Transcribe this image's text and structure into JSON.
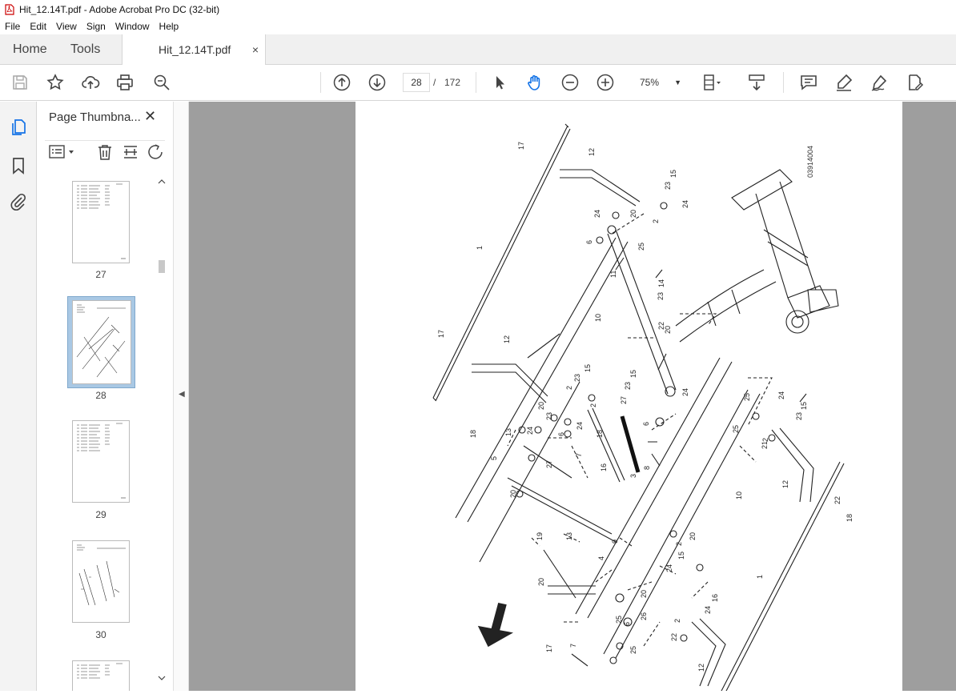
{
  "window": {
    "title": "Hit_12.14T.pdf - Adobe Acrobat Pro DC (32-bit)"
  },
  "menu": [
    "File",
    "Edit",
    "View",
    "Sign",
    "Window",
    "Help"
  ],
  "tabs": {
    "home": "Home",
    "tools": "Tools",
    "document": "Hit_12.14T.pdf",
    "close": "×"
  },
  "toolbar": {
    "icons": [
      "save-icon",
      "star-icon",
      "upload-icon",
      "print-icon",
      "zoom-search-icon",
      "page-up-icon",
      "page-down-icon",
      "select-cursor-icon",
      "hand-icon",
      "zoom-out-icon",
      "zoom-in-icon",
      "fit-page-icon",
      "scroll-mode-icon",
      "comment-icon",
      "highlight-icon",
      "sign-icon",
      "edit-icon"
    ],
    "current_page": "28",
    "page_sep": "/",
    "total_pages": "172",
    "zoom": "75%"
  },
  "thumbnails": {
    "title": "Page Thumbna...",
    "close": "✕",
    "pages": [
      {
        "label": "27"
      },
      {
        "label": "28",
        "selected": true
      },
      {
        "label": "29"
      },
      {
        "label": "30"
      }
    ]
  },
  "document": {
    "figure_code": "03914004",
    "callouts": [
      "1",
      "1",
      "2",
      "2",
      "2",
      "2",
      "2",
      "2",
      "3",
      "4",
      "5",
      "6",
      "6",
      "6",
      "6",
      "7",
      "7",
      "8",
      "9",
      "10",
      "10",
      "11",
      "12",
      "12",
      "12",
      "12",
      "13",
      "13",
      "14",
      "15",
      "15",
      "15",
      "15",
      "15",
      "16",
      "16",
      "17",
      "17",
      "17",
      "18",
      "18",
      "18",
      "19",
      "20",
      "20",
      "20",
      "20",
      "20",
      "20",
      "20",
      "21",
      "22",
      "22",
      "22",
      "23",
      "23",
      "23",
      "23",
      "23",
      "23",
      "24",
      "24",
      "24",
      "24",
      "24",
      "24",
      "24",
      "24",
      "25",
      "25",
      "25",
      "25",
      "25",
      "26",
      "27",
      "27"
    ],
    "colors": {
      "accent": "#1a73e8",
      "hand_tool": "#1473e6",
      "doc_bg": "#9e9e9e"
    }
  }
}
